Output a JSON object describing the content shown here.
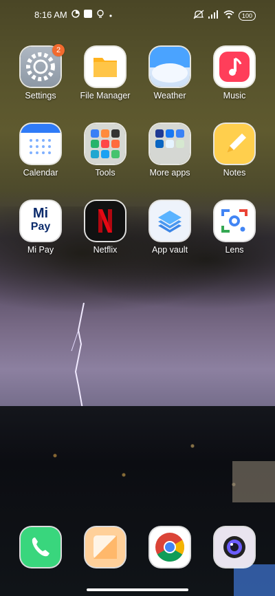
{
  "status_bar": {
    "time": "8:16 AM",
    "battery": "100"
  },
  "apps": [
    {
      "label": "Settings",
      "badge": "2"
    },
    {
      "label": "File Manager"
    },
    {
      "label": "Weather"
    },
    {
      "label": "Music"
    },
    {
      "label": "Calendar"
    },
    {
      "label": "Tools"
    },
    {
      "label": "More apps"
    },
    {
      "label": "Notes"
    },
    {
      "label": "Mi Pay",
      "icon_text_top": "Mi",
      "icon_text_bottom": "Pay"
    },
    {
      "label": "Netflix"
    },
    {
      "label": "App vault"
    },
    {
      "label": "Lens"
    }
  ],
  "dock": [
    "phone-icon",
    "gallery-icon",
    "chrome-icon",
    "camera-icon"
  ]
}
